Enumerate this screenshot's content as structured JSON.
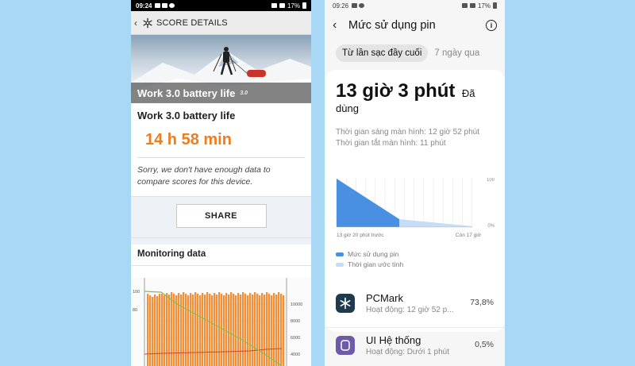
{
  "left_phone": {
    "status_bar": {
      "time": "09:24",
      "battery": "17%"
    },
    "header": {
      "title": "SCORE DETAILS",
      "back_icon": "chevron-left-icon",
      "logo_icon": "snowflake-logo-icon"
    },
    "hero": {
      "label": "Work 3.0 battery life",
      "version": "3.0"
    },
    "result": {
      "title": "Work 3.0 battery life",
      "value": "14 h 58 min"
    },
    "notice": "Sorry, we don't have enough data to compare scores for this device.",
    "share_label": "SHARE",
    "monitoring_title": "Monitoring data",
    "monitor_chart": {
      "left_ticks": [
        "100",
        "80"
      ],
      "right_ticks": [
        "10000",
        "8000",
        "6000",
        "4000"
      ]
    }
  },
  "right_phone": {
    "status_bar": {
      "time": "09:26",
      "battery": "17%"
    },
    "header": {
      "title": "Mức sử dụng pin",
      "back_icon": "chevron-left-icon",
      "info_icon": "info-icon"
    },
    "tabs": {
      "active": "Từ lần sạc đầy cuối",
      "inactive": "7 ngày qua"
    },
    "usage": {
      "main": "13 giờ 3 phút",
      "suffix": "Đã dùng",
      "screen_on": "Thời gian sáng màn hình: 12 giờ 52 phút",
      "screen_off": "Thời gian tắt màn hình: 11 phút"
    },
    "chart": {
      "y_top": "100",
      "y_bottom": "0%",
      "x_left": "13 giờ 20 phút trước",
      "x_right": "Còn 17 giờ",
      "colors": {
        "usage": "#4a90e2",
        "estimate": "#c5def5"
      }
    },
    "legend": {
      "usage": "Mức sử dụng pin",
      "estimate": "Thời gian ước tính"
    },
    "apps": [
      {
        "name": "PCMark",
        "sub": "Hoạt động: 12 giờ 52 p...",
        "pct": "73,8%",
        "icon": "pcmark-snowflake-icon"
      },
      {
        "name": "UI Hệ thống",
        "sub": "Hoạt động: Dưới 1 phút",
        "pct": "0,5%",
        "icon": "system-ui-icon"
      }
    ]
  }
}
